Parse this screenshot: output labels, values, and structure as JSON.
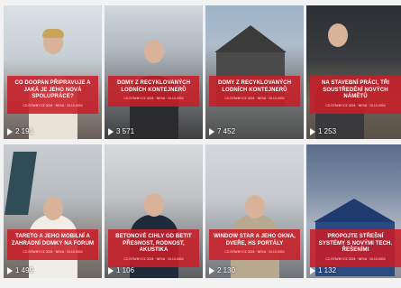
{
  "videos": [
    {
      "title": "CO DOOPAN PŘIPRAVUJE A JAKÁ JE JEHO NOVÁ SPOLUPRÁCE?",
      "meta": "CZ-STAVBY.CZ 2024 · NEXA · 10.10.2024",
      "views": "2 191"
    },
    {
      "title": "DOMY Z RECYKLOVANÝCH LODNÍCH KONTEJNERŮ",
      "meta": "CZ-STAVBY.CZ 2024 · NEXA · 10.10.2024",
      "views": "3 571"
    },
    {
      "title": "DOMY Z RECYKLOVANÝCH LODNÍCH KONTEJNERŮ",
      "meta": "CZ-STAVBY.CZ 2024 · NEXA · 10.10.2024",
      "views": "7 452"
    },
    {
      "title": "NA STAVEBNÍ PRÁCI, TŘI SOUSTŘEDĚNÍ NOVÝCH NÁMĚTŮ",
      "meta": "CZ-STAVBY.CZ 2024 · NEXA · 10.10.2024",
      "views": "1 253"
    },
    {
      "title": "TARETO A JEHO MOBILNÍ A ZAHRADNÍ DOMKY NA FORUM",
      "meta": "CZ-STAVBY.CZ 2024 · NEXA · 10.10.2024",
      "views": "1 499"
    },
    {
      "title": "BETONOVÉ CIHLY OD BETIT PŘESNOST, RODNOST, AKUSTIKA",
      "meta": "CZ-STAVBY.CZ 2024 · NEXA · 10.10.2024",
      "views": "1 106"
    },
    {
      "title": "WINDOW STAR A JEHO OKNA, DVEŘE, HS PORTÁLY",
      "meta": "CZ-STAVBY.CZ 2024 · NEXA · 10.10.2024",
      "views": "2 130"
    },
    {
      "title": "PROPOJTE STŘEŠNÍ SYSTÉMY S NOVÝMI TECH. ŘEŠENÍMI",
      "meta": "CZ-STAVBY.CZ 2024 · NEXA · 10.10.2024",
      "views": "1 132"
    }
  ],
  "colors": {
    "caption_bg": "#c81e28"
  }
}
